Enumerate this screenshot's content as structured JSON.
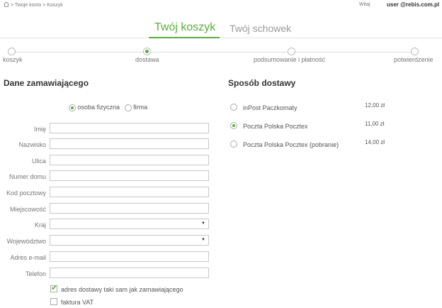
{
  "topbar": {
    "breadcrumb": "> Twoje konto > Koszyk",
    "greeting": "Witaj",
    "user": "user @rebis.com.pl"
  },
  "tabs": {
    "cart": "Twój koszyk",
    "wishlist": "Twój schowek"
  },
  "steps": [
    {
      "label": "koszyk",
      "active": false
    },
    {
      "label": "dostawa",
      "active": true
    },
    {
      "label": "podsumowanie i płatność",
      "active": false
    },
    {
      "label": "potwierdzenie",
      "active": false
    }
  ],
  "customer": {
    "title": "Dane zamawiającego",
    "type_person": "osoba fizyczna",
    "type_company": "firma",
    "selected_type": "osoba fizyczna",
    "fields": {
      "first_name": {
        "label": "Imię",
        "value": ""
      },
      "last_name": {
        "label": "Nazwisko",
        "value": ""
      },
      "street": {
        "label": "Ulica",
        "value": ""
      },
      "house_number": {
        "label": "Numer domu",
        "value": ""
      },
      "postal_code": {
        "label": "Kod pocztowy",
        "value": ""
      },
      "city": {
        "label": "Miejscowość",
        "value": ""
      },
      "country": {
        "label": "Kraj",
        "value": ""
      },
      "voivodeship": {
        "label": "Województwo",
        "value": ""
      },
      "email": {
        "label": "Adres e-mail",
        "value": ""
      },
      "phone": {
        "label": "Telefon",
        "value": ""
      }
    },
    "same_address": {
      "label": "adres dostawy taki sam jak zamawiającego",
      "checked": true
    },
    "vat_invoice": {
      "label": "faktura VAT",
      "checked": false
    }
  },
  "shipping": {
    "title": "Sposób dostawy",
    "options": [
      {
        "name": "inPost Paczkomaty",
        "price": "12,00 zł",
        "selected": false
      },
      {
        "name": "Poczta Polska Pocztex",
        "price": "11,00 zł",
        "selected": true
      },
      {
        "name": "Poczta Polska Pocztex (pobranie)",
        "price": "14,00 zł",
        "selected": false
      }
    ]
  },
  "colors": {
    "accent": "#5aae3c",
    "border": "#c8c8c8",
    "muted": "#9a9a9a"
  },
  "icons": {
    "home": "home-icon",
    "select_arrow": "chevron-down-icon",
    "check": "checkmark-icon"
  }
}
